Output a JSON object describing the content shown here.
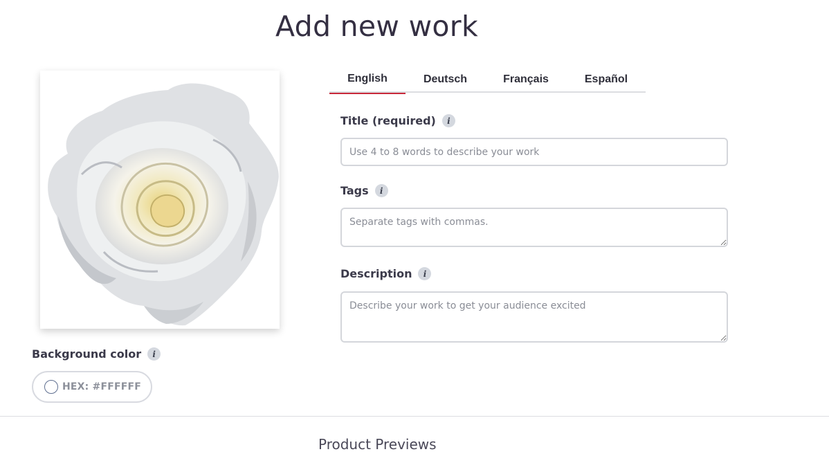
{
  "page": {
    "title": "Add new work",
    "section_heading": "Product Previews"
  },
  "artwork": {
    "image_subject": "white-rose"
  },
  "background_color": {
    "label": "Background color",
    "info_icon": "info-icon",
    "hex_text": "HEX: #FFFFFF",
    "swatch_color": "#FFFFFF"
  },
  "language_tabs": [
    {
      "label": "English",
      "active": true
    },
    {
      "label": "Deutsch",
      "active": false
    },
    {
      "label": "Français",
      "active": false
    },
    {
      "label": "Español",
      "active": false
    }
  ],
  "form": {
    "title": {
      "label": "Title (required)",
      "value": "",
      "placeholder": "Use 4 to 8 words to describe your work"
    },
    "tags": {
      "label": "Tags",
      "value": "",
      "placeholder": "Separate tags with commas."
    },
    "description": {
      "label": "Description",
      "value": "",
      "placeholder": "Describe your work to get your audience excited"
    }
  },
  "colors": {
    "accent_tab_underline": "#C8293A",
    "heading": "#342F42",
    "border": "#D4D6DB"
  }
}
